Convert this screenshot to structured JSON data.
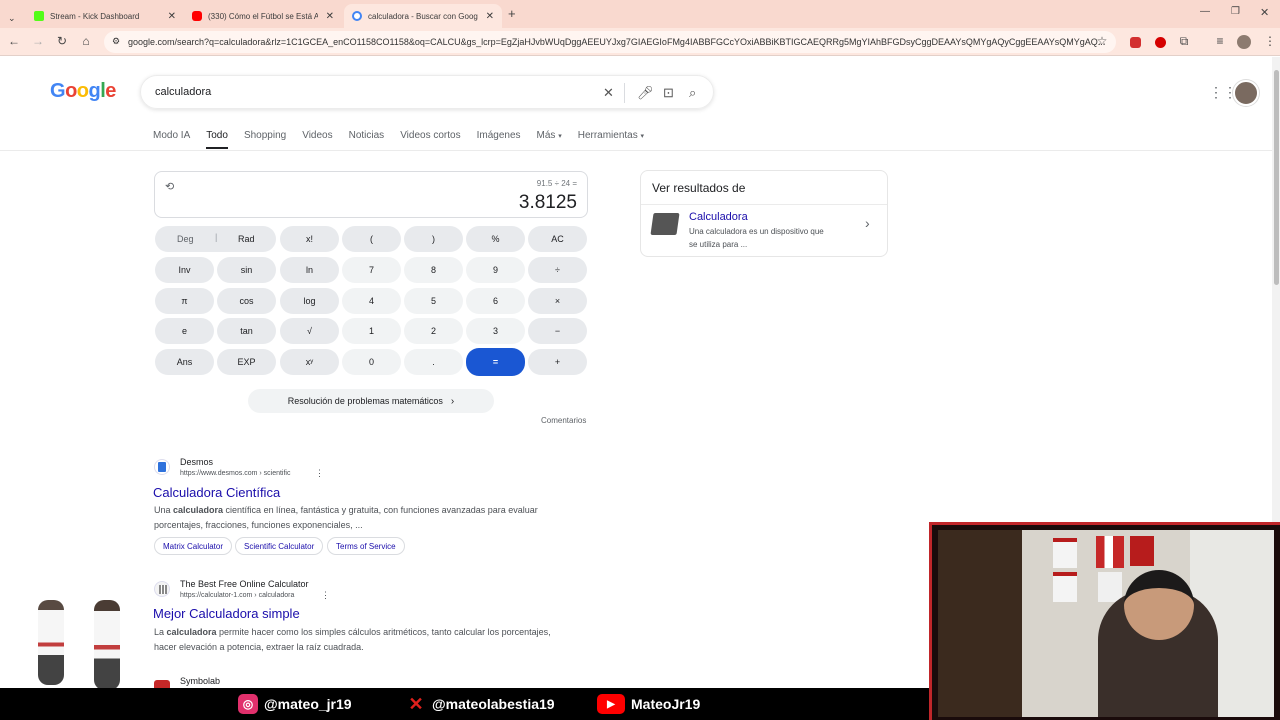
{
  "browser": {
    "tabs": [
      {
        "title": "Stream - Kick Dashboard",
        "favicon_color": "#53fc18",
        "active": false
      },
      {
        "title": "(330) Cómo el Fútbol se Está Al",
        "favicon_color": "#ff0000",
        "active": false
      },
      {
        "title": "calculadora - Buscar con Googl",
        "favicon_color": "#4285f4",
        "active": true
      }
    ],
    "new_tab_symbol": "+",
    "url": "google.com/search?q=calculadora&rlz=1C1GCEA_enCO1158CO1158&oq=CALCU&gs_lcrp=EgZjaHJvbWUqDggAEEUYJxg7GIAEGIoFMg4IABBFGCcYOxiABBiKBTIGCAEQRRg5MgYIAhBFGDsyCggDEAAYsQMYgAQyCggEEAAYsQMYgAQ..."
  },
  "google": {
    "logo": [
      "G",
      "o",
      "o",
      "g",
      "l",
      "e"
    ],
    "logo_colors": [
      "#4285f4",
      "#ea4335",
      "#fbbc05",
      "#4285f4",
      "#34a853",
      "#ea4335"
    ],
    "query": "calculadora",
    "nav": [
      "Modo IA",
      "Todo",
      "Shopping",
      "Videos",
      "Noticias",
      "Videos cortos",
      "Imágenes",
      "Más",
      "Herramientas"
    ],
    "active_nav": "Todo"
  },
  "calculator": {
    "expression": "91.5 ÷ 24 =",
    "result": "3.8125",
    "deg": "Deg",
    "rad": "Rad",
    "keys": [
      [
        "x!",
        "(",
        ")",
        "%",
        "AC"
      ],
      [
        "Inv",
        "sin",
        "ln",
        "7",
        "8",
        "9",
        "÷"
      ],
      [
        "π",
        "cos",
        "log",
        "4",
        "5",
        "6",
        "×"
      ],
      [
        "e",
        "tan",
        "√",
        "1",
        "2",
        "3",
        "−"
      ],
      [
        "Ans",
        "EXP",
        "xʸ",
        "0",
        ".",
        "=",
        "+"
      ]
    ],
    "math_button": "Resolución de problemas matemáticos",
    "feedback": "Comentarios"
  },
  "knowledge_panel": {
    "heading": "Ver resultados de",
    "title": "Calculadora",
    "desc_line1": "Una calculadora es un dispositivo que",
    "desc_line2": "se utiliza para ..."
  },
  "results": [
    {
      "site": "Desmos",
      "url": "https://www.desmos.com › scientific",
      "title": "Calculadora Científica",
      "snip1_pre": "Una ",
      "snip1_bold": "calculadora",
      "snip1_post": " científica en línea, fantástica y gratuita, con funciones avanzadas para evaluar",
      "snip2": "porcentajes, fracciones, funciones exponenciales, ...",
      "chips": [
        "Matrix Calculator",
        "Scientific Calculator",
        "Terms of Service"
      ]
    },
    {
      "site": "The Best Free Online Calculator",
      "url": "https://calculator-1.com › calculadora",
      "title": "Mejor Calculadora simple",
      "snip1_pre": "La ",
      "snip1_bold": "calculadora",
      "snip1_post": " permite hacer como los simples cálculos aritméticos, tanto calcular los porcentajes,",
      "snip2": "hacer elevación a potencia, extraer la raíz cuadrada."
    },
    {
      "site": "Symbolab"
    }
  ],
  "overlay": {
    "socials": [
      {
        "handle": "@mateo_jr19",
        "icon": "instagram-icon",
        "color": "#e1306c"
      },
      {
        "handle": "@mateolabestia19",
        "icon": "x-icon",
        "color": "#e0201c"
      },
      {
        "handle": "MateoJr19",
        "icon": "youtube-icon",
        "color": "#ff0000"
      }
    ]
  }
}
